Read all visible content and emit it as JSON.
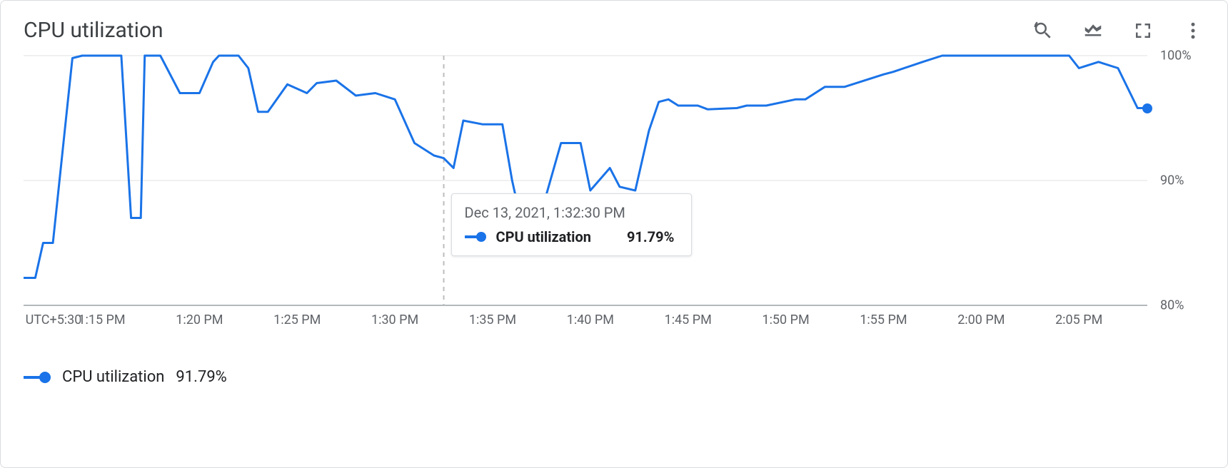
{
  "header": {
    "title": "CPU utilization"
  },
  "toolbar": {
    "zoom_reset": "Reset zoom",
    "legend_toggle": "Toggle legend",
    "fullscreen": "Full screen",
    "more": "More options"
  },
  "axes": {
    "timezone_label": "UTC+5:30",
    "x_ticks": [
      "1:15 PM",
      "1:20 PM",
      "1:25 PM",
      "1:30 PM",
      "1:35 PM",
      "1:40 PM",
      "1:45 PM",
      "1:50 PM",
      "1:55 PM",
      "2:00 PM",
      "2:05 PM"
    ],
    "y_ticks": [
      "100%",
      "90%",
      "80%"
    ]
  },
  "tooltip": {
    "timestamp": "Dec 13, 2021, 1:32:30 PM",
    "series_label": "CPU utilization",
    "value": "91.79%"
  },
  "legend": {
    "label": "CPU utilization",
    "value": "91.79%"
  },
  "colors": {
    "series": "#1a73e8",
    "grid": "#e0e0e0",
    "axis": "#9aa0a6",
    "cursor": "#bdbdbd"
  },
  "chart_data": {
    "type": "line",
    "title": "CPU utilization",
    "xlabel": "",
    "ylabel": "",
    "ylim": [
      80,
      100
    ],
    "x_unit": "minutes after 1:00 PM (UTC+5:30), Dec 13, 2021",
    "cursor_x": 32.5,
    "series": [
      {
        "name": "CPU utilization",
        "x": [
          11.0,
          11.6,
          12.0,
          12.5,
          13.5,
          14.0,
          14.5,
          16.0,
          16.5,
          17.0,
          17.2,
          18.0,
          19.0,
          19.3,
          20.0,
          20.7,
          21.0,
          22.0,
          22.5,
          23.0,
          23.5,
          24.5,
          25.5,
          26.0,
          27.0,
          28.0,
          29.0,
          30.0,
          31.0,
          32.0,
          32.5,
          33.0,
          33.5,
          34.5,
          35.5,
          36.0,
          36.5,
          37.5,
          38.5,
          39.5,
          40.0,
          41.0,
          41.5,
          42.3,
          43.0,
          43.5,
          44.0,
          44.5,
          45.5,
          46.0,
          47.5,
          48.0,
          49.0,
          50.5,
          51.0,
          52.0,
          53.0,
          55.0,
          55.5,
          57.0,
          58.0,
          60.0,
          62.0,
          64.5,
          65.0,
          66.0,
          67.0,
          68.0,
          68.5
        ],
        "values": [
          82.2,
          82.2,
          85.0,
          85.0,
          99.8,
          100.0,
          100.0,
          100.0,
          87.0,
          87.0,
          100.0,
          100.0,
          97.0,
          97.0,
          97.0,
          99.5,
          100.0,
          100.0,
          99.0,
          95.5,
          95.5,
          97.7,
          97.0,
          97.8,
          98.0,
          96.8,
          97.0,
          96.5,
          93.0,
          92.0,
          91.79,
          91.0,
          94.8,
          94.5,
          94.5,
          90.0,
          86.5,
          87.5,
          93.0,
          93.0,
          89.2,
          91.0,
          89.5,
          89.2,
          94.0,
          96.3,
          96.5,
          96.0,
          96.0,
          95.7,
          95.8,
          96.0,
          96.0,
          96.5,
          96.5,
          97.5,
          97.5,
          98.5,
          98.7,
          99.5,
          100.0,
          100.0,
          100.0,
          100.0,
          99.0,
          99.5,
          99.0,
          95.8,
          95.8
        ]
      }
    ]
  }
}
